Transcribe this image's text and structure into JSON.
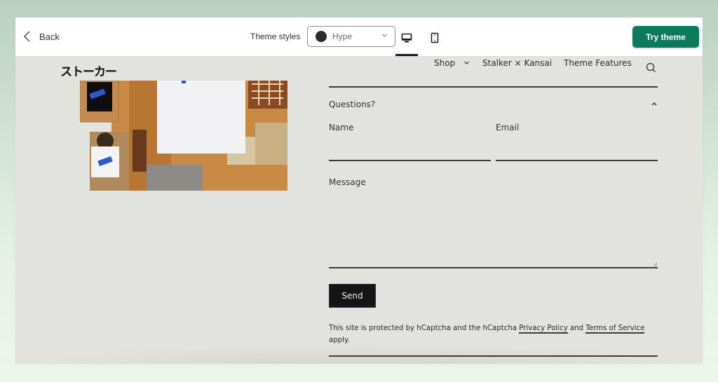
{
  "toolbar": {
    "back_label": "Back",
    "theme_styles_label": "Theme styles",
    "style_select": {
      "value": "Hype",
      "swatch_color": "#2b2b2b"
    },
    "views": [
      {
        "name": "desktop",
        "icon": "desktop-icon",
        "active": true
      },
      {
        "name": "mobile",
        "icon": "mobile-icon",
        "active": false
      }
    ],
    "try_theme_label": "Try theme",
    "accent_color": "#0d7a5b"
  },
  "store": {
    "logo": "ストーカー",
    "nav": [
      {
        "label": "Shop",
        "has_dropdown": true
      },
      {
        "label": "Stalker × Kansai",
        "has_dropdown": false
      },
      {
        "label": "Theme Features",
        "has_dropdown": false
      }
    ],
    "search_icon": "search-icon",
    "hero_image_alt": "Collage of white and black t-shirts with blue eraser print on orange patterned fabric"
  },
  "contact_form": {
    "title": "Questions?",
    "expanded": true,
    "fields": {
      "name": {
        "label": "Name",
        "value": ""
      },
      "email": {
        "label": "Email",
        "value": ""
      },
      "message": {
        "label": "Message",
        "value": ""
      }
    },
    "send_label": "Send",
    "legal": {
      "prefix": "This site is protected by hCaptcha and the hCaptcha ",
      "privacy_link": "Privacy Policy",
      "middle": " and ",
      "terms_link": "Terms of Service",
      "suffix": " apply."
    }
  }
}
